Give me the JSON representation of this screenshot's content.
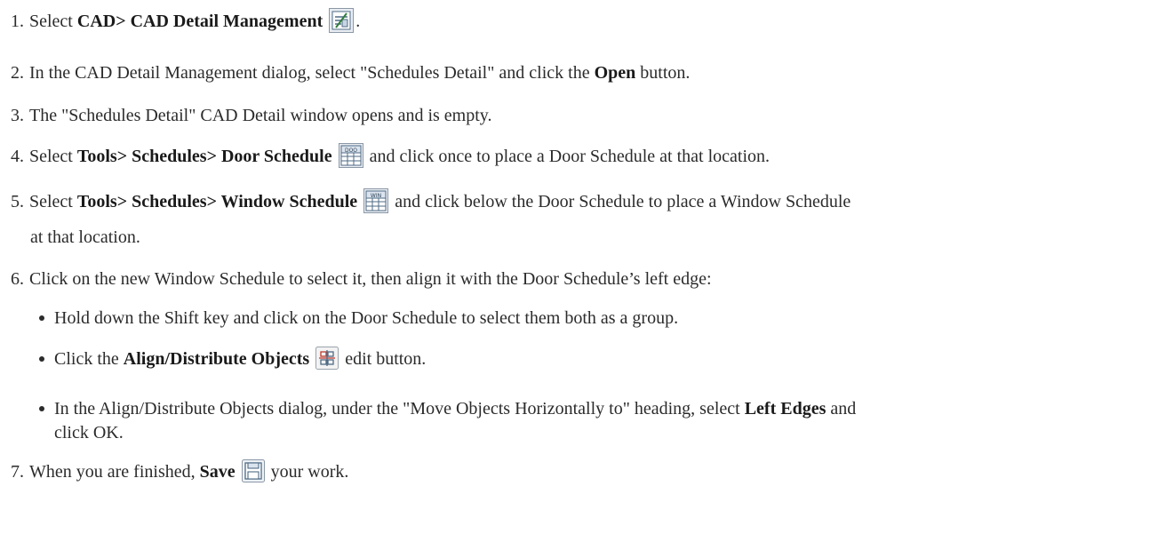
{
  "steps": [
    {
      "num": "1.",
      "pre": "Select ",
      "bold": "CAD> CAD Detail Management",
      "icon": "cad-detail-management-icon",
      "post": "."
    },
    {
      "num": "2.",
      "pre": "In the CAD Detail Management dialog, select \"Schedules Detail\" and click the ",
      "bold": "Open",
      "post": " button."
    },
    {
      "num": "3.",
      "text": "The \"Schedules Detail\" CAD Detail window opens and is empty."
    },
    {
      "num": "4.",
      "pre": "Select ",
      "bold": "Tools> Schedules> Door Schedule",
      "icon": "door-schedule-icon",
      "icon_label": "DOO",
      "post": " and click once to place a Door Schedule at that location."
    },
    {
      "num": "5.",
      "pre": "Select ",
      "bold": "Tools> Schedules> Window Schedule",
      "icon": "window-schedule-icon",
      "icon_label": "WIN",
      "post": " and click below the Door Schedule to place a Window Schedule",
      "line2": "at that location."
    },
    {
      "num": "6.",
      "text": "Click on the new Window Schedule to select it, then align it with the Door Schedule’s left edge:"
    },
    {
      "num": "7.",
      "pre": "When you are finished, ",
      "bold": "Save",
      "icon": "save-icon",
      "post": " your work."
    }
  ],
  "bullets": [
    {
      "text": "Hold down the Shift key and click on the Door Schedule to select them both as a group."
    },
    {
      "pre": "Click the ",
      "bold": "Align/Distribute Objects",
      "icon": "align-distribute-icon",
      "post": " edit button."
    },
    {
      "pre": "In the Align/Distribute Objects dialog, under the \"Move Objects Horizontally to\" heading, select ",
      "bold": "Left Edges",
      "post": " and",
      "line2": "click OK."
    }
  ]
}
